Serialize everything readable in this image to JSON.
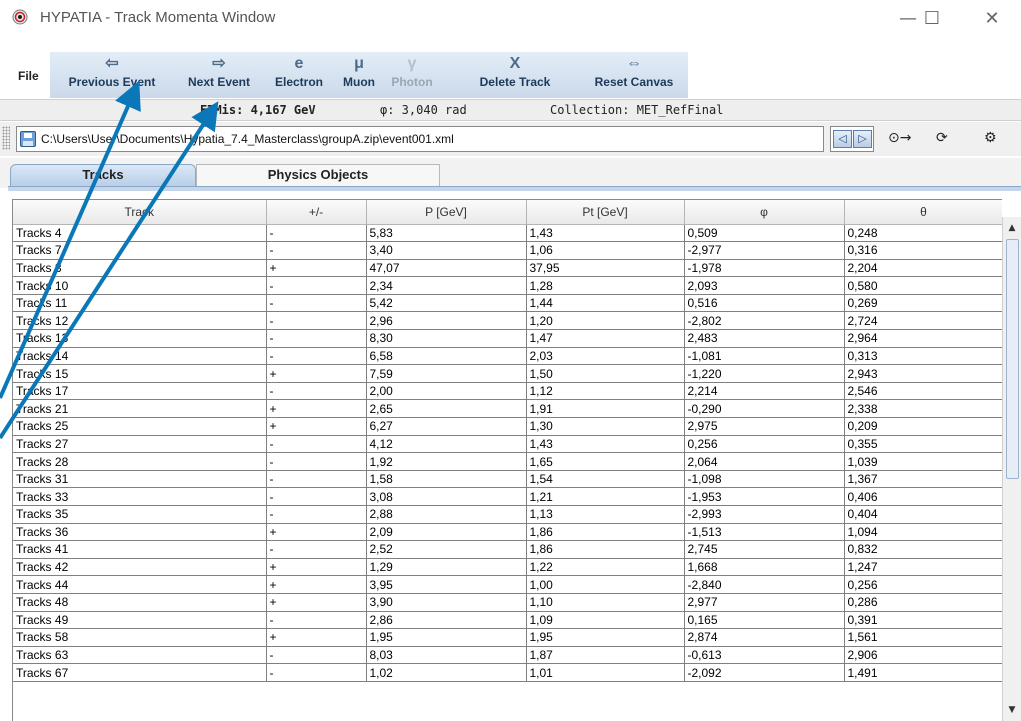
{
  "window": {
    "title": "HYPATIA - Track Momenta Window",
    "minimize_glyph": "—",
    "maximize_glyph": "☐",
    "close_glyph": "✕"
  },
  "menu": {
    "file": "File"
  },
  "toolbar": {
    "previous_event": {
      "label": "Previous Event",
      "icon": "⇦"
    },
    "next_event": {
      "label": "Next Event",
      "icon": "⇨"
    },
    "electron": {
      "label": "Electron",
      "icon": "e"
    },
    "muon": {
      "label": "Muon",
      "icon": "μ"
    },
    "photon": {
      "label": "Photon",
      "icon": "γ"
    },
    "delete_track": {
      "label": "Delete Track",
      "icon": "X"
    },
    "reset_canvas": {
      "label": "Reset Canvas",
      "icon": "⇔"
    }
  },
  "info": {
    "etmis": "ETMis: 4,167 GeV",
    "phi": "φ: 3,040 rad",
    "collection": "Collection: MET_RefFinal"
  },
  "path": {
    "value": "C:\\Users\\User\\Documents\\Hypatia_7.4_Masterclass\\groupA.zip\\event001.xml",
    "prev_glyph": "◁",
    "next_glyph": "▷",
    "tool1": "⊙→",
    "tool2": "⟳",
    "tool3": "⚙"
  },
  "tabs": {
    "tracks": "Tracks",
    "physics_objects": "Physics Objects"
  },
  "table": {
    "headers": [
      "Track",
      "+/-",
      "P [GeV]",
      "Pt [GeV]",
      "φ",
      "θ"
    ],
    "rows": [
      [
        "Tracks 4",
        "-",
        "5,83",
        "1,43",
        "0,509",
        "0,248"
      ],
      [
        "Tracks 7",
        "-",
        "3,40",
        "1,06",
        "-2,977",
        "0,316"
      ],
      [
        "Tracks 8",
        "+",
        "47,07",
        "37,95",
        "-1,978",
        "2,204"
      ],
      [
        "Tracks 10",
        "-",
        "2,34",
        "1,28",
        "2,093",
        "0,580"
      ],
      [
        "Tracks 11",
        "-",
        "5,42",
        "1,44",
        "0,516",
        "0,269"
      ],
      [
        "Tracks 12",
        "-",
        "2,96",
        "1,20",
        "-2,802",
        "2,724"
      ],
      [
        "Tracks 13",
        "-",
        "8,30",
        "1,47",
        "2,483",
        "2,964"
      ],
      [
        "Tracks 14",
        "-",
        "6,58",
        "2,03",
        "-1,081",
        "0,313"
      ],
      [
        "Tracks 15",
        "+",
        "7,59",
        "1,50",
        "-1,220",
        "2,943"
      ],
      [
        "Tracks 17",
        "-",
        "2,00",
        "1,12",
        "2,214",
        "2,546"
      ],
      [
        "Tracks 21",
        "+",
        "2,65",
        "1,91",
        "-0,290",
        "2,338"
      ],
      [
        "Tracks 25",
        "+",
        "6,27",
        "1,30",
        "2,975",
        "0,209"
      ],
      [
        "Tracks 27",
        "-",
        "4,12",
        "1,43",
        "0,256",
        "0,355"
      ],
      [
        "Tracks 28",
        "-",
        "1,92",
        "1,65",
        "2,064",
        "1,039"
      ],
      [
        "Tracks 31",
        "-",
        "1,58",
        "1,54",
        "-1,098",
        "1,367"
      ],
      [
        "Tracks 33",
        "-",
        "3,08",
        "1,21",
        "-1,953",
        "0,406"
      ],
      [
        "Tracks 35",
        "-",
        "2,88",
        "1,13",
        "-2,993",
        "0,404"
      ],
      [
        "Tracks 36",
        "+",
        "2,09",
        "1,86",
        "-1,513",
        "1,094"
      ],
      [
        "Tracks 41",
        "-",
        "2,52",
        "1,86",
        "2,745",
        "0,832"
      ],
      [
        "Tracks 42",
        "+",
        "1,29",
        "1,22",
        "1,668",
        "1,247"
      ],
      [
        "Tracks 44",
        "+",
        "3,95",
        "1,00",
        "-2,840",
        "0,256"
      ],
      [
        "Tracks 48",
        "+",
        "3,90",
        "1,10",
        "2,977",
        "0,286"
      ],
      [
        "Tracks 49",
        "-",
        "2,86",
        "1,09",
        "0,165",
        "0,391"
      ],
      [
        "Tracks 58",
        "+",
        "1,95",
        "1,95",
        "2,874",
        "1,561"
      ],
      [
        "Tracks 63",
        "-",
        "8,03",
        "1,87",
        "-0,613",
        "2,906"
      ],
      [
        "Tracks 67",
        "-",
        "1,02",
        "1,01",
        "-2,092",
        "1,491"
      ]
    ]
  },
  "colors": {
    "annotation_arrow": "#0a78b8",
    "toolbar_gradient_top": "#e3edf7",
    "toolbar_gradient_bottom": "#cad9ea"
  }
}
